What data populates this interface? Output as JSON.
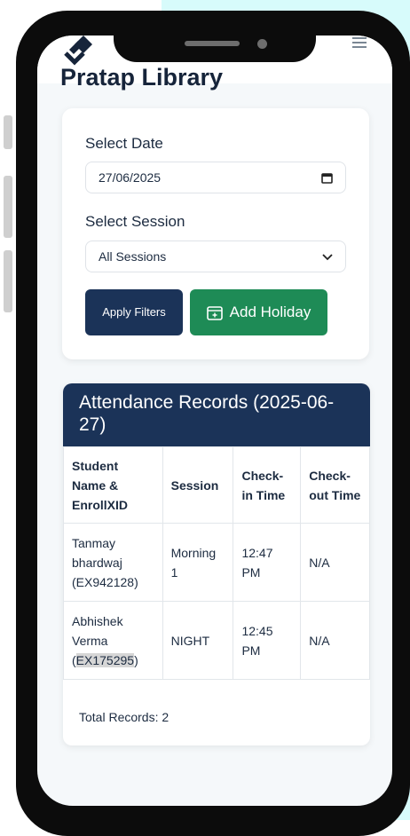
{
  "app": {
    "title": "Pratap Library"
  },
  "filters": {
    "date_label": "Select Date",
    "date_value": "27/06/2025",
    "session_label": "Select Session",
    "session_value": "All Sessions",
    "apply_label": "Apply Filters",
    "holiday_label": "Add Holiday"
  },
  "records": {
    "title": "Attendance Records (2025-06-27)",
    "columns": [
      "Student Name & EnrollXID",
      "Session",
      "Check-in Time",
      "Check-out Time"
    ],
    "rows": [
      {
        "name": "Tanmay bhardwaj",
        "enroll": "EX942128",
        "session": "Morning 1",
        "checkin": "12:47 PM",
        "checkout": "N/A"
      },
      {
        "name": "Abhishek Verma",
        "enroll": "EX175295",
        "session": "NIGHT",
        "checkin": "12:45 PM",
        "checkout": "N/A"
      }
    ],
    "total_label": "Total Records: 2"
  },
  "colors": {
    "navy": "#1b3358",
    "green": "#1e8b56",
    "background": "#f5f8fa"
  },
  "icons": {
    "logo": "diamond-logo-icon",
    "menu": "hamburger-menu-icon",
    "calendar": "calendar-icon",
    "chevron": "chevron-down-icon",
    "add": "calendar-add-icon"
  }
}
